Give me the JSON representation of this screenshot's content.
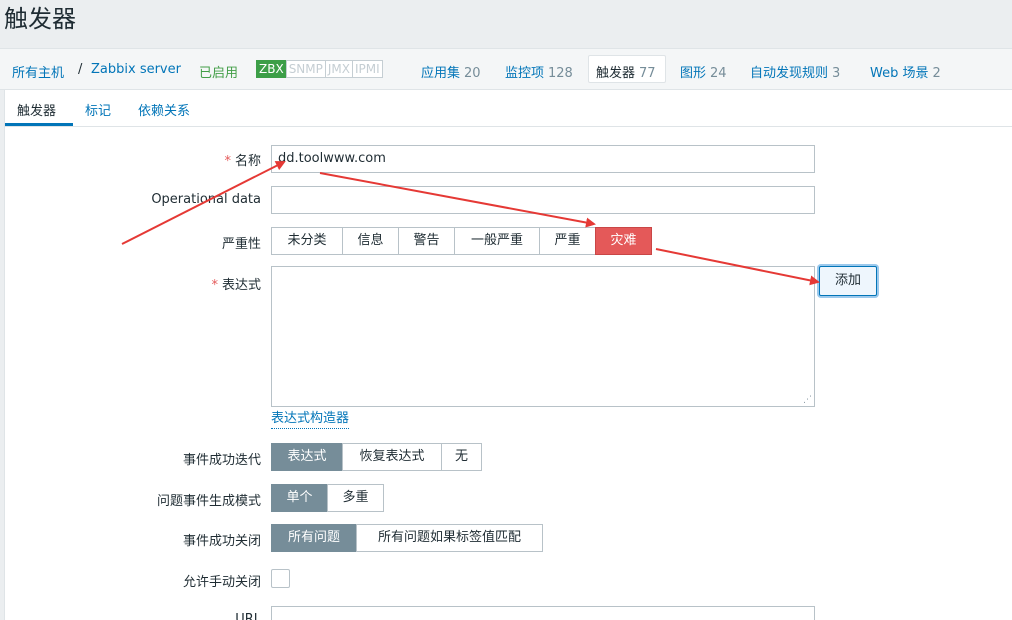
{
  "page": {
    "title": "触发器"
  },
  "hostnav": {
    "all_hosts": "所有主机",
    "separator": "/",
    "host": "Zabbix server",
    "status": "已启用",
    "availability": [
      "ZBX",
      "SNMP",
      "JMX",
      "IPMI"
    ],
    "applications": {
      "label": "应用集",
      "count": "20"
    },
    "items": {
      "label": "监控项",
      "count": "128"
    },
    "triggers": {
      "label": "触发器",
      "count": "77"
    },
    "graphs": {
      "label": "图形",
      "count": "24"
    },
    "discovery": {
      "label": "自动发现规则",
      "count": "3"
    },
    "web": {
      "label": "Web 场景",
      "count": "2"
    }
  },
  "tabs": [
    "触发器",
    "标记",
    "依赖关系"
  ],
  "form": {
    "name": {
      "label": "名称",
      "required": "*",
      "value": "dd.toolwww.com"
    },
    "opdata": {
      "label": "Operational data",
      "value": ""
    },
    "severity": {
      "label": "严重性",
      "options": [
        "未分类",
        "信息",
        "警告",
        "一般严重",
        "严重",
        "灾难"
      ],
      "selected": "灾难"
    },
    "expression": {
      "label": "表达式",
      "required": "*",
      "value": "",
      "add_button": "添加",
      "builder_link": "表达式构造器"
    },
    "ok_event": {
      "label": "事件成功迭代",
      "options": [
        "表达式",
        "恢复表达式",
        "无"
      ],
      "selected": "表达式"
    },
    "problem_mode": {
      "label": "问题事件生成模式",
      "options": [
        "单个",
        "多重"
      ],
      "selected": "单个"
    },
    "ok_close": {
      "label": "事件成功关闭",
      "options": [
        "所有问题",
        "所有问题如果标签值匹配"
      ],
      "selected": "所有问题"
    },
    "manual_close": {
      "label": "允许手动关闭",
      "checked": false
    },
    "url": {
      "label": "URL",
      "value": ""
    }
  },
  "colors": {
    "annotation_arrow": "#e53935",
    "disaster": "#e45959",
    "selected_segment": "#768d99",
    "link": "#0275b8"
  }
}
